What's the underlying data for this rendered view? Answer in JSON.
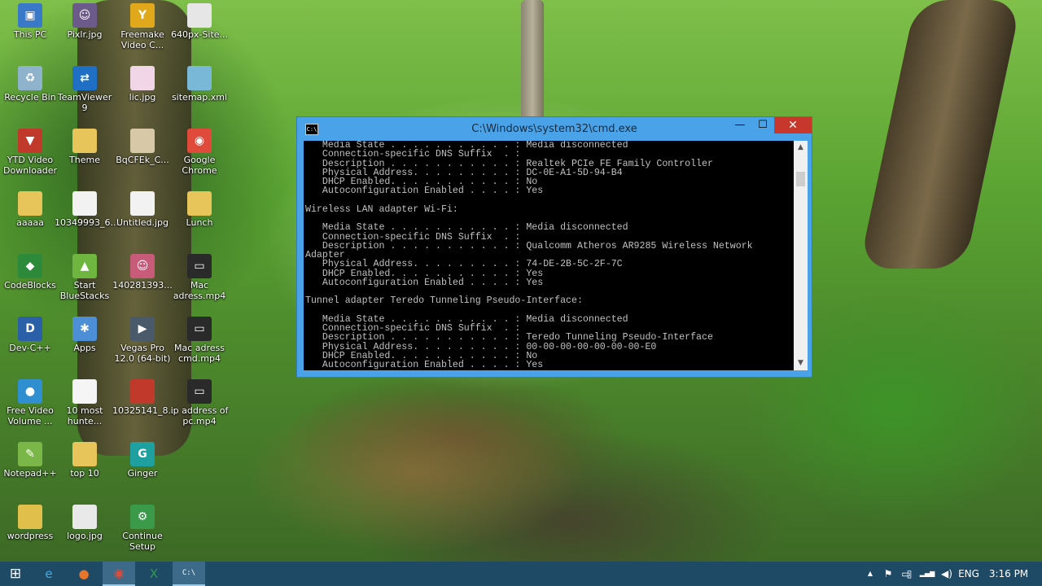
{
  "desktop_icons": [
    {
      "label": "This PC",
      "icon": "computer-icon",
      "color": "#3a78c8",
      "glyph": "▣"
    },
    {
      "label": "Recycle Bin",
      "icon": "recycle-bin-icon",
      "color": "#8fb3cc",
      "glyph": "♻"
    },
    {
      "label": "YTD Video Downloader",
      "icon": "ytd-icon",
      "color": "#c0392b",
      "glyph": "▼"
    },
    {
      "label": "aaaaa",
      "icon": "folder-icon",
      "color": "#e8c55a",
      "glyph": ""
    },
    {
      "label": "CodeBlocks",
      "icon": "codeblocks-icon",
      "color": "#2d8a3a",
      "glyph": "◆"
    },
    {
      "label": "Dev-C++",
      "icon": "devcpp-icon",
      "color": "#2b5fa8",
      "glyph": "D"
    },
    {
      "label": "Free Video Volume ...",
      "icon": "free-video-icon",
      "color": "#2f8fd0",
      "glyph": "●"
    },
    {
      "label": "Notepad++",
      "icon": "notepad-icon",
      "color": "#7ab648",
      "glyph": "✎"
    },
    {
      "label": "wordpress",
      "icon": "folder-zip-icon",
      "color": "#e0c04a",
      "glyph": ""
    },
    {
      "label": "Pixlr.jpg",
      "icon": "image-icon",
      "color": "#6b5a8a",
      "glyph": "☺"
    },
    {
      "label": "TeamViewer 9",
      "icon": "teamviewer-icon",
      "color": "#1f6fc4",
      "glyph": "⇄"
    },
    {
      "label": "Theme",
      "icon": "folder-icon",
      "color": "#e8c55a",
      "glyph": ""
    },
    {
      "label": "10349993_6...",
      "icon": "image-icon",
      "color": "#f2f2f2",
      "glyph": ""
    },
    {
      "label": "Start BlueStacks",
      "icon": "bluestacks-icon",
      "color": "#6fb640",
      "glyph": "▲"
    },
    {
      "label": "Apps",
      "icon": "apps-icon",
      "color": "#4c8fd6",
      "glyph": "✱"
    },
    {
      "label": "10 most hunte...",
      "icon": "document-icon",
      "color": "#f5f5f5",
      "glyph": ""
    },
    {
      "label": "top 10",
      "icon": "folder-icon",
      "color": "#e8c55a",
      "glyph": ""
    },
    {
      "label": "logo.jpg",
      "icon": "image-icon",
      "color": "#e9e9e9",
      "glyph": ""
    },
    {
      "label": "Freemake Video C...",
      "icon": "freemake-icon",
      "color": "#e0a81a",
      "glyph": "Y"
    },
    {
      "label": "lic.jpg",
      "icon": "image-icon",
      "color": "#f0d6e6",
      "glyph": ""
    },
    {
      "label": "BqCFEk_C...",
      "icon": "image-icon",
      "color": "#d7c9a8",
      "glyph": ""
    },
    {
      "label": "Untitled.jpg",
      "icon": "image-icon",
      "color": "#f2f2f2",
      "glyph": ""
    },
    {
      "label": "140281393...",
      "icon": "image-icon",
      "color": "#c85a7a",
      "glyph": "☺"
    },
    {
      "label": "Vegas Pro 12.0 (64-bit)",
      "icon": "vegas-icon",
      "color": "#4a5a6a",
      "glyph": "▶"
    },
    {
      "label": "10325141_8...",
      "icon": "image-icon",
      "color": "#c0392b",
      "glyph": ""
    },
    {
      "label": "Ginger",
      "icon": "ginger-icon",
      "color": "#1fa0a0",
      "glyph": "G"
    },
    {
      "label": "Continue Setup",
      "icon": "setup-icon",
      "color": "#3a9a4a",
      "glyph": "⚙"
    },
    {
      "label": "640px-Site...",
      "icon": "document-icon",
      "color": "#e6e6e6",
      "glyph": ""
    },
    {
      "label": "sitemap.xml",
      "icon": "xml-file-icon",
      "color": "#7ab8d8",
      "glyph": ""
    },
    {
      "label": "Google Chrome",
      "icon": "chrome-icon",
      "color": "#e04a3a",
      "glyph": "◉"
    },
    {
      "label": "Lunch",
      "icon": "folder-icon",
      "color": "#e8c55a",
      "glyph": ""
    },
    {
      "label": "Mac adress.mp4",
      "icon": "video-file-icon",
      "color": "#2a2a2a",
      "glyph": "▭"
    },
    {
      "label": "Mac adress cmd.mp4",
      "icon": "video-file-icon",
      "color": "#2a2a2a",
      "glyph": "▭"
    },
    {
      "label": "ip address of pc.mp4",
      "icon": "video-file-icon",
      "color": "#2a2a2a",
      "glyph": "▭"
    }
  ],
  "cmd_window": {
    "title": "C:\\Windows\\system32\\cmd.exe",
    "title_icon": "C:\\",
    "minimize_glyph": "—",
    "maximize_glyph": "☐",
    "close_glyph": "✕",
    "scroll_up_glyph": "▲",
    "scroll_down_glyph": "▼",
    "console_lines": [
      "   Media State . . . . . . . . . . . : Media disconnected",
      "   Connection-specific DNS Suffix  . :",
      "   Description . . . . . . . . . . . : Realtek PCIe FE Family Controller",
      "   Physical Address. . . . . . . . . : DC-0E-A1-5D-94-B4",
      "   DHCP Enabled. . . . . . . . . . . : No",
      "   Autoconfiguration Enabled . . . . : Yes",
      "",
      "Wireless LAN adapter Wi-Fi:",
      "",
      "   Media State . . . . . . . . . . . : Media disconnected",
      "   Connection-specific DNS Suffix  . :",
      "   Description . . . . . . . . . . . : Qualcomm Atheros AR9285 Wireless Network",
      "Adapter",
      "   Physical Address. . . . . . . . . : 74-DE-2B-5C-2F-7C",
      "   DHCP Enabled. . . . . . . . . . . : Yes",
      "   Autoconfiguration Enabled . . . . : Yes",
      "",
      "Tunnel adapter Teredo Tunneling Pseudo-Interface:",
      "",
      "   Media State . . . . . . . . . . . : Media disconnected",
      "   Connection-specific DNS Suffix  . :",
      "   Description . . . . . . . . . . . : Teredo Tunneling Pseudo-Interface",
      "   Physical Address. . . . . . . . . : 00-00-00-00-00-00-00-E0",
      "   DHCP Enabled. . . . . . . . . . . : No",
      "   Autoconfiguration Enabled . . . . : Yes"
    ]
  },
  "taskbar": {
    "start_glyph": "⊞",
    "pinned": [
      {
        "name": "ie-icon",
        "glyph": "e",
        "color": "#3ab0e8"
      },
      {
        "name": "firefox-icon",
        "glyph": "●",
        "color": "#e8752a"
      },
      {
        "name": "chrome-icon",
        "glyph": "◉",
        "color": "#e04a3a"
      },
      {
        "name": "excel-icon",
        "glyph": "X",
        "color": "#2d9a4a"
      },
      {
        "name": "cmd-icon",
        "glyph": "C:\\",
        "color": "#ffffff"
      }
    ],
    "tray_up_glyph": "▲",
    "flag_glyph": "⚑",
    "network_glyph": "▭",
    "battery_glyph": "▯",
    "volume_glyph": "◀)",
    "signal_glyph": "▂▄▆",
    "language": "ENG",
    "time": "3:16 PM"
  }
}
